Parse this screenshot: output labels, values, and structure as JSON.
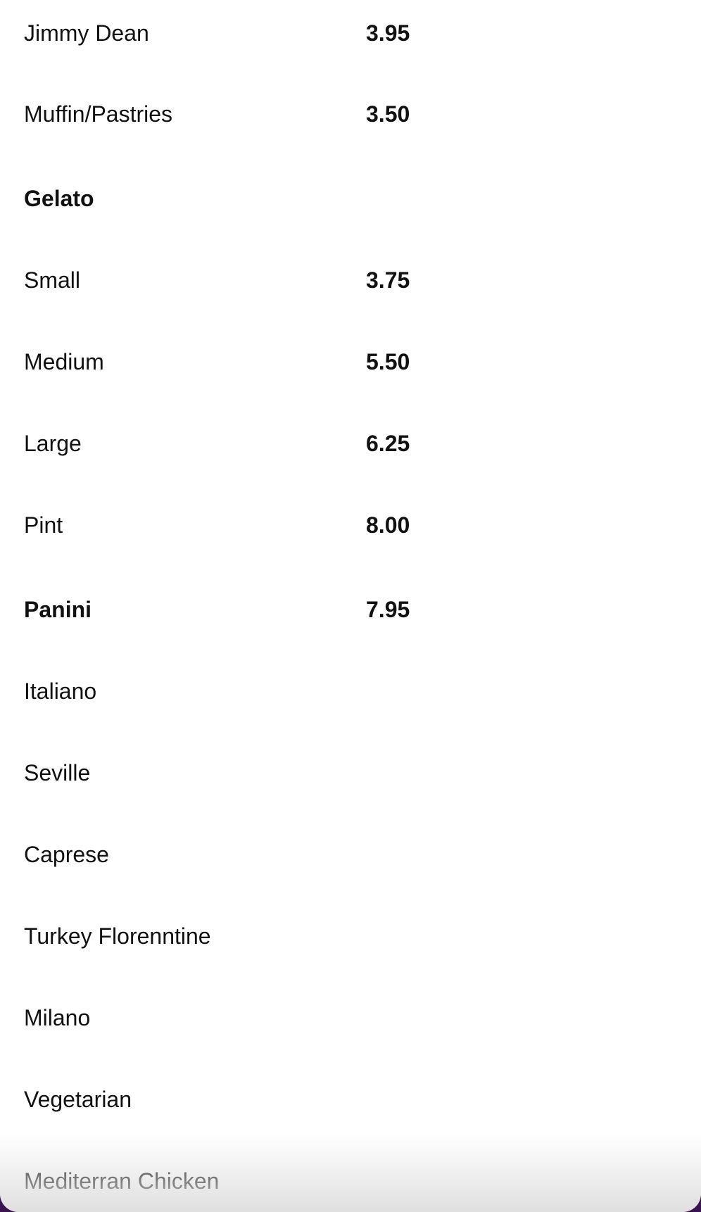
{
  "menu": {
    "items": [
      {
        "name": "Jimmy Dean",
        "price": "3.95"
      },
      {
        "name": "Muffin/Pastries",
        "price": "3.50"
      },
      {
        "name": "Gelato",
        "price": ""
      },
      {
        "name": "Small",
        "price": "3.75"
      },
      {
        "name": "Medium",
        "price": "5.50"
      },
      {
        "name": "Large",
        "price": "6.25"
      },
      {
        "name": "Pint",
        "price": "8.00"
      },
      {
        "name": "Panini",
        "price": "7.95"
      },
      {
        "name": "Italiano",
        "price": ""
      },
      {
        "name": "Seville",
        "price": ""
      },
      {
        "name": "Caprese",
        "price": ""
      },
      {
        "name": "Turkey Florenntine",
        "price": ""
      },
      {
        "name": "Milano",
        "price": ""
      },
      {
        "name": "Vegetarian",
        "price": ""
      },
      {
        "name": "Mediterran Chicken",
        "price": ""
      }
    ]
  }
}
